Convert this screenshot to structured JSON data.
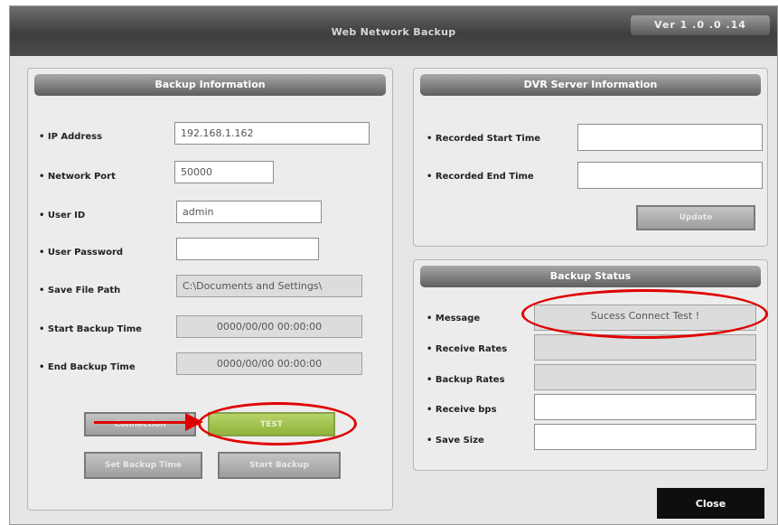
{
  "window": {
    "title": "Web Network Backup",
    "version": "Ver 1 .0 .0 .14"
  },
  "backup_info": {
    "header": "Backup Information",
    "ip_label": "IP Address",
    "ip_value": "192.168.1.162",
    "port_label": "Network Port",
    "port_value": "50000",
    "user_id_label": "User ID",
    "user_id_value": "admin",
    "password_label": "User Password",
    "password_value": "",
    "save_path_label": "Save File Path",
    "save_path_value": "C:\\Documents and Settings\\",
    "start_time_label": "Start Backup Time",
    "start_time_value": "0000/00/00 00:00:00",
    "end_time_label": "End Backup Time",
    "end_time_value": "0000/00/00 00:00:00",
    "buttons": {
      "connection": "Connection",
      "test": "TEST",
      "set_backup_time": "Set Backup Time",
      "start_backup": "Start Backup"
    }
  },
  "dvr_info": {
    "header": "DVR Server Information",
    "recorded_start_label": "Recorded Start Time",
    "recorded_start_value": "",
    "recorded_end_label": "Recorded End Time",
    "recorded_end_value": "",
    "update_button": "Update"
  },
  "backup_status": {
    "header": "Backup Status",
    "message_label": "Message",
    "message_value": "Sucess Connect Test !",
    "receive_rates_label": "Receive Rates",
    "receive_rates_value": "",
    "backup_rates_label": "Backup Rates",
    "backup_rates_value": "",
    "receive_bps_label": "Receive bps",
    "receive_bps_value": "",
    "save_size_label": "Save Size",
    "save_size_value": ""
  },
  "close_button": "Close",
  "annotation_color": "#e00000"
}
